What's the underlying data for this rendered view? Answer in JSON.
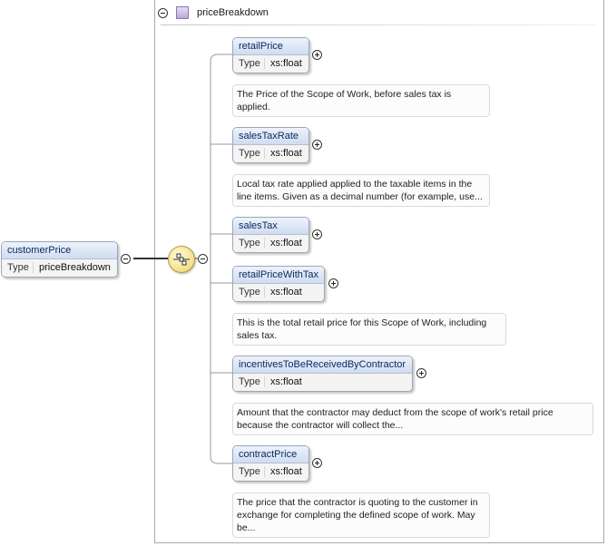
{
  "root": {
    "name": "customerPrice",
    "type_label": "Type",
    "type_value": "priceBreakdown"
  },
  "group": {
    "title": "priceBreakdown"
  },
  "elements": [
    {
      "name": "retailPrice",
      "type_label": "Type",
      "type_value": "xs:float",
      "doc": "The Price of the Scope of Work, before sales tax is applied."
    },
    {
      "name": "salesTaxRate",
      "type_label": "Type",
      "type_value": "xs:float",
      "doc": "Local tax rate applied applied to the taxable items in the line items. Given as a decimal number (for example, use..."
    },
    {
      "name": "salesTax",
      "type_label": "Type",
      "type_value": "xs:float",
      "doc": ""
    },
    {
      "name": "retailPriceWithTax",
      "type_label": "Type",
      "type_value": "xs:float",
      "doc": "This is the total retail price for this Scope of Work, including sales tax."
    },
    {
      "name": "incentivesToBeReceivedByContractor",
      "type_label": "Type",
      "type_value": "xs:float",
      "doc": "Amount that the contractor may deduct from the scope of work's retail price because the contractor will collect the..."
    },
    {
      "name": "contractPrice",
      "type_label": "Type",
      "type_value": "xs:float",
      "doc": "The price that the contractor is quoting to the customer in exchange for completing the defined scope of work. May be..."
    }
  ]
}
